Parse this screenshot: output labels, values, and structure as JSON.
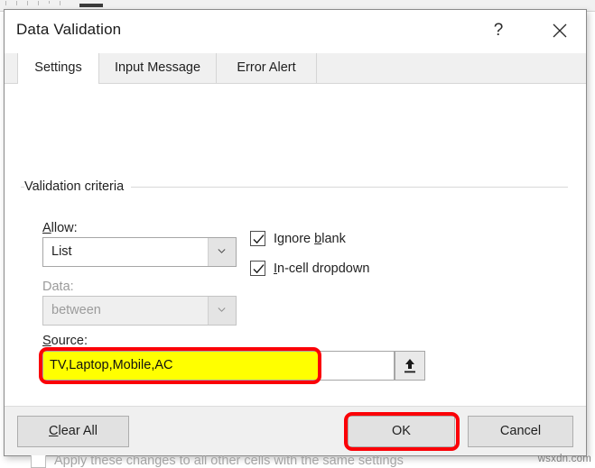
{
  "dialog": {
    "title": "Data Validation",
    "help_glyph": "?",
    "help_icon": "question-mark-icon",
    "close_icon": "close-icon"
  },
  "tabs": [
    {
      "label": "Settings",
      "active": true
    },
    {
      "label": "Input Message",
      "active": false
    },
    {
      "label": "Error Alert",
      "active": false
    }
  ],
  "settings": {
    "group_label": "Validation criteria",
    "allow": {
      "label_pre": "",
      "label_acc": "A",
      "label_post": "llow:",
      "label": "Allow:",
      "value": "List",
      "enabled": true,
      "arrow_icon": "chevron-down-icon"
    },
    "data": {
      "label": "Data:",
      "value": "between",
      "enabled": false,
      "arrow_icon": "chevron-down-icon"
    },
    "source": {
      "label_acc": "S",
      "label_post": "ource:",
      "label": "Source:",
      "value": "TV,Laptop,Mobile,AC",
      "highlight_color": "#ffff00",
      "range_button_icon": "range-select-up-arrow-icon"
    },
    "ignore_blank": {
      "label_pre": "Ignore ",
      "label_acc": "b",
      "label_post": "lank",
      "label": "Ignore blank",
      "checked": true,
      "enabled": true
    },
    "in_cell_dropdown": {
      "label_pre": "",
      "label_acc": "I",
      "label_post": "n-cell dropdown",
      "label": "In-cell dropdown",
      "checked": true,
      "enabled": true
    },
    "apply_all": {
      "label": "Apply these changes to all other cells with the same settings",
      "checked": false,
      "enabled": false
    }
  },
  "footer": {
    "clear_all": {
      "label_acc": "C",
      "label_post": "lear All",
      "label": "Clear All"
    },
    "ok": {
      "label": "OK"
    },
    "cancel": {
      "label": "Cancel"
    }
  },
  "annotations": {
    "color": "#fb0007",
    "targets": [
      "source-input",
      "ok-button"
    ]
  },
  "watermark": {
    "text": "wsxdn.com"
  }
}
